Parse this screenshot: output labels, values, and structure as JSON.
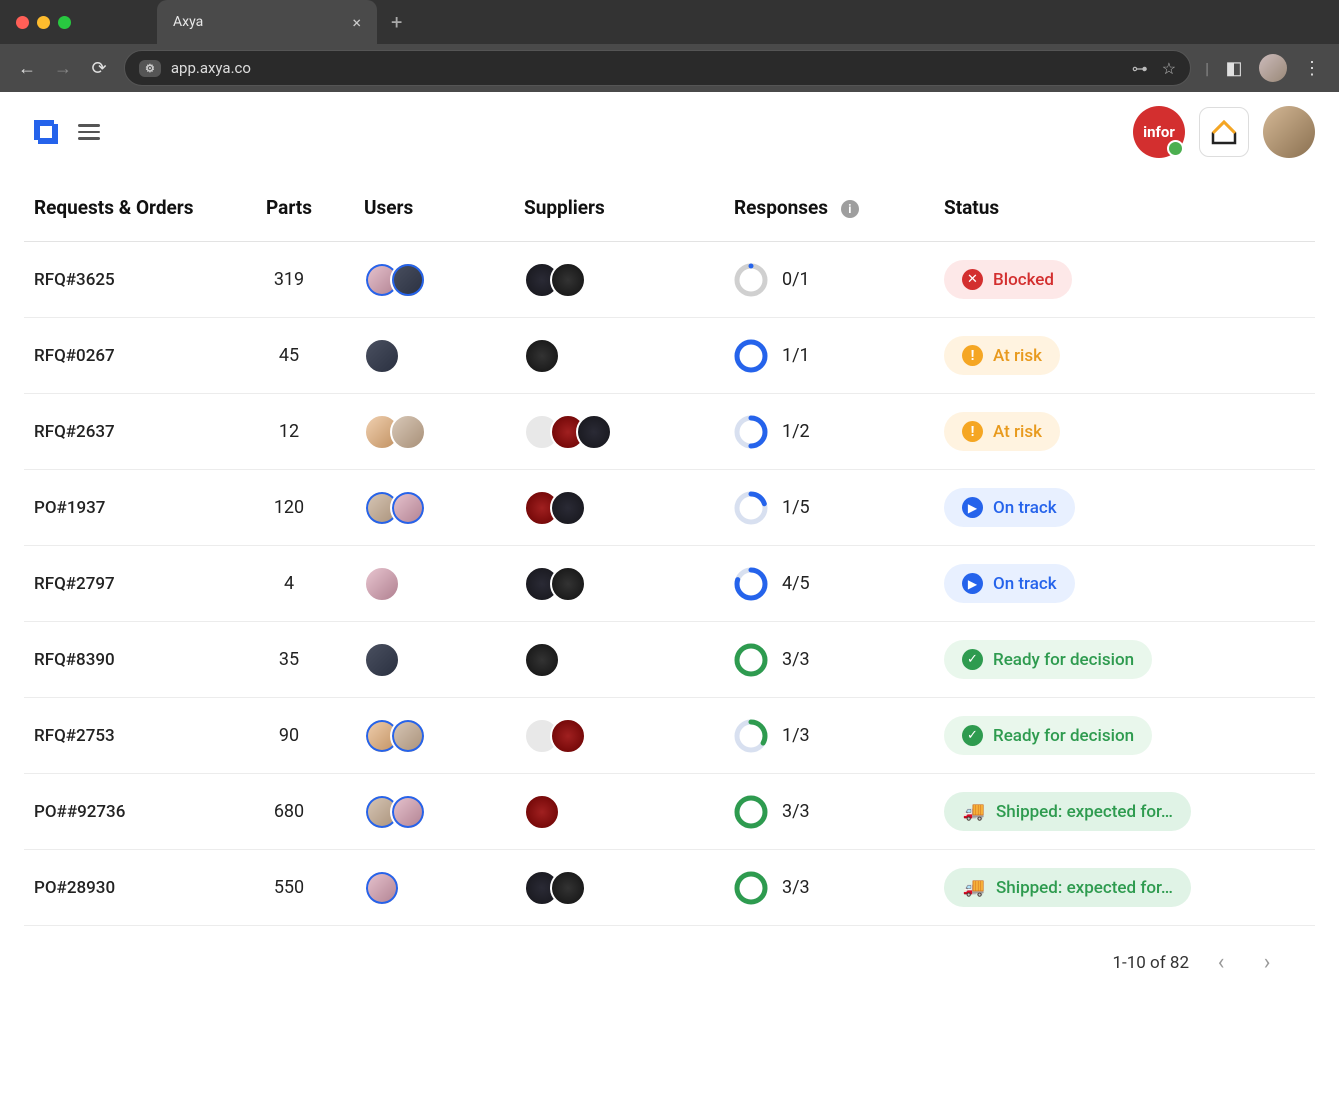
{
  "browser": {
    "tab_title": "Axya",
    "url": "app.axya.co"
  },
  "header": {
    "integration_label": "infor"
  },
  "table": {
    "headers": {
      "requests": "Requests & Orders",
      "parts": "Parts",
      "users": "Users",
      "suppliers": "Suppliers",
      "responses": "Responses",
      "status": "Status"
    },
    "rows": [
      {
        "id": "RFQ#3625",
        "parts": "319",
        "users": 2,
        "suppliers": 2,
        "resp_n": 0,
        "resp_d": 1,
        "resp_label": "0/1",
        "status_key": "blocked",
        "status_label": "Blocked"
      },
      {
        "id": "RFQ#0267",
        "parts": "45",
        "users": 1,
        "suppliers": 1,
        "resp_n": 1,
        "resp_d": 1,
        "resp_label": "1/1",
        "status_key": "atrisk",
        "status_label": "At risk"
      },
      {
        "id": "RFQ#2637",
        "parts": "12",
        "users": 2,
        "suppliers": 3,
        "resp_n": 1,
        "resp_d": 2,
        "resp_label": "1/2",
        "status_key": "atrisk",
        "status_label": "At risk"
      },
      {
        "id": "PO#1937",
        "parts": "120",
        "users": 2,
        "suppliers": 2,
        "resp_n": 1,
        "resp_d": 5,
        "resp_label": "1/5",
        "status_key": "ontrack",
        "status_label": "On track"
      },
      {
        "id": "RFQ#2797",
        "parts": "4",
        "users": 1,
        "suppliers": 2,
        "resp_n": 4,
        "resp_d": 5,
        "resp_label": "4/5",
        "status_key": "ontrack",
        "status_label": "On track"
      },
      {
        "id": "RFQ#8390",
        "parts": "35",
        "users": 1,
        "suppliers": 1,
        "resp_n": 3,
        "resp_d": 3,
        "resp_label": "3/3",
        "status_key": "ready",
        "status_label": "Ready for decision"
      },
      {
        "id": "RFQ#2753",
        "parts": "90",
        "users": 2,
        "suppliers": 2,
        "resp_n": 1,
        "resp_d": 3,
        "resp_label": "1/3",
        "status_key": "ready",
        "status_label": "Ready for decision"
      },
      {
        "id": "PO##92736",
        "parts": "680",
        "users": 2,
        "suppliers": 1,
        "resp_n": 3,
        "resp_d": 3,
        "resp_label": "3/3",
        "status_key": "shipped",
        "status_label": "Shipped: expected for…"
      },
      {
        "id": "PO#28930",
        "parts": "550",
        "users": 1,
        "suppliers": 2,
        "resp_n": 3,
        "resp_d": 3,
        "resp_label": "3/3",
        "status_key": "shipped",
        "status_label": "Shipped: expected for…"
      }
    ]
  },
  "pagination": {
    "label": "1-10 of 82"
  },
  "status_colors": {
    "blocked": "#d32f2f",
    "atrisk": "#f5a623",
    "ontrack": "#2563eb",
    "ready": "#2e9b4f",
    "shipped": "#2e9b4f"
  }
}
